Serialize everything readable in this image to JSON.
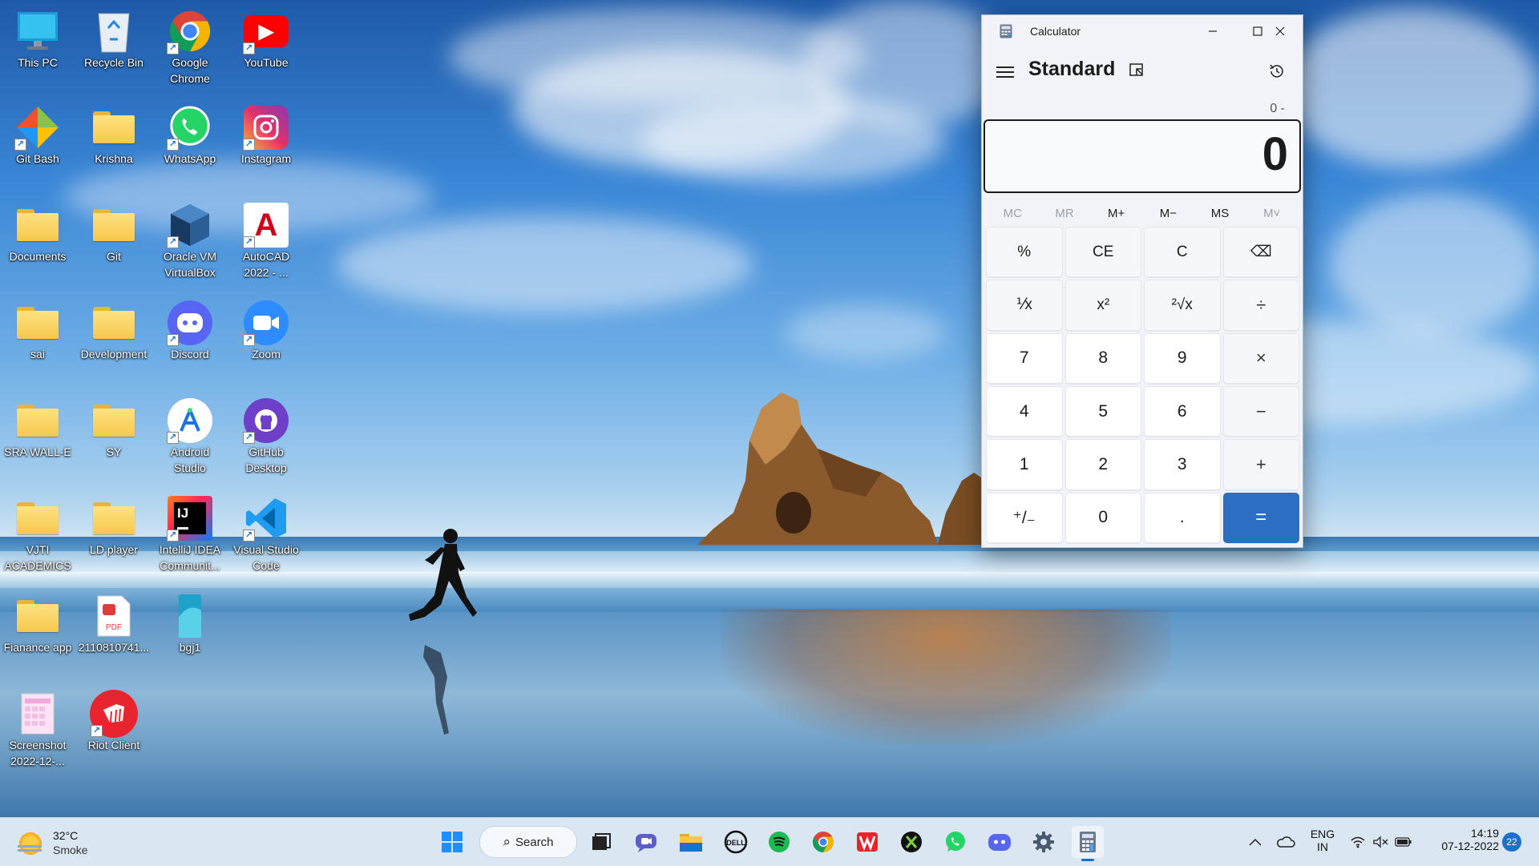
{
  "desktop": {
    "icons": [
      {
        "label_lines": [
          "This PC"
        ],
        "icon": "this-pc-icon"
      },
      {
        "label_lines": [
          "Recycle Bin"
        ],
        "icon": "recycle-bin-icon"
      },
      {
        "label_lines": [
          "Google",
          "Chrome"
        ],
        "icon": "chrome-icon"
      },
      {
        "label_lines": [
          "YouTube"
        ],
        "icon": "youtube-icon"
      },
      {
        "label_lines": [
          "Git Bash"
        ],
        "icon": "git-bash-icon"
      },
      {
        "label_lines": [
          "Krishna"
        ],
        "icon": "folder-icon"
      },
      {
        "label_lines": [
          "WhatsApp"
        ],
        "icon": "whatsapp-icon"
      },
      {
        "label_lines": [
          "Instagram"
        ],
        "icon": "instagram-icon"
      },
      {
        "label_lines": [
          "Documents"
        ],
        "icon": "folder-icon"
      },
      {
        "label_lines": [
          "Git"
        ],
        "icon": "folder-icon"
      },
      {
        "label_lines": [
          "Oracle VM",
          "VirtualBox"
        ],
        "icon": "virtualbox-icon"
      },
      {
        "label_lines": [
          "AutoCAD",
          "2022 - ..."
        ],
        "icon": "autocad-icon"
      },
      {
        "label_lines": [
          "sai"
        ],
        "icon": "folder-icon"
      },
      {
        "label_lines": [
          "Development"
        ],
        "icon": "folder-icon"
      },
      {
        "label_lines": [
          "Discord"
        ],
        "icon": "discord-icon"
      },
      {
        "label_lines": [
          "Zoom"
        ],
        "icon": "zoom-icon"
      },
      {
        "label_lines": [
          "SRA WALL-E"
        ],
        "icon": "folder-icon"
      },
      {
        "label_lines": [
          "SY"
        ],
        "icon": "folder-icon"
      },
      {
        "label_lines": [
          "Android",
          "Studio"
        ],
        "icon": "android-studio-icon"
      },
      {
        "label_lines": [
          "GitHub",
          "Desktop"
        ],
        "icon": "github-desktop-icon"
      },
      {
        "label_lines": [
          "VJTI",
          "ACADEMICS"
        ],
        "icon": "folder-icon"
      },
      {
        "label_lines": [
          "LD player"
        ],
        "icon": "folder-icon"
      },
      {
        "label_lines": [
          "IntelliJ IDEA",
          "Communit..."
        ],
        "icon": "intellij-icon"
      },
      {
        "label_lines": [
          "Visual Studio",
          "Code"
        ],
        "icon": "vscode-icon"
      },
      {
        "label_lines": [
          "Fianance app"
        ],
        "icon": "folder-icon"
      },
      {
        "label_lines": [
          "2110810741..."
        ],
        "icon": "pdf-file-icon"
      },
      {
        "label_lines": [
          "bgj1"
        ],
        "icon": "image-file-icon"
      },
      {
        "label_lines": [
          "Screenshot",
          "2022-12-..."
        ],
        "icon": "screenshot-file-icon"
      },
      {
        "label_lines": [
          "Riot Client"
        ],
        "icon": "riot-client-icon"
      }
    ]
  },
  "calculator": {
    "window_title": "Calculator",
    "mode_title": "Standard",
    "expression": "0 -",
    "display_value": "0",
    "memory_buttons": [
      {
        "label": "MC",
        "enabled": false
      },
      {
        "label": "MR",
        "enabled": false
      },
      {
        "label": "M+",
        "enabled": true
      },
      {
        "label": "M−",
        "enabled": true
      },
      {
        "label": "MS",
        "enabled": true
      },
      {
        "label": "M˅",
        "enabled": false
      }
    ],
    "keys": [
      {
        "label": "%",
        "kind": "fn",
        "name": "percent-key"
      },
      {
        "label": "CE",
        "kind": "fn",
        "name": "clear-entry-key"
      },
      {
        "label": "C",
        "kind": "fn",
        "name": "clear-key"
      },
      {
        "label": "⌫",
        "kind": "fn",
        "name": "backspace-key"
      },
      {
        "label": "⅟x",
        "kind": "fn",
        "name": "reciprocal-key"
      },
      {
        "label": "x²",
        "kind": "fn",
        "name": "square-key"
      },
      {
        "label": "²√x",
        "kind": "fn",
        "name": "square-root-key"
      },
      {
        "label": "÷",
        "kind": "op",
        "name": "divide-key"
      },
      {
        "label": "7",
        "kind": "num",
        "name": "digit-7-key"
      },
      {
        "label": "8",
        "kind": "num",
        "name": "digit-8-key"
      },
      {
        "label": "9",
        "kind": "num",
        "name": "digit-9-key"
      },
      {
        "label": "×",
        "kind": "op",
        "name": "multiply-key"
      },
      {
        "label": "4",
        "kind": "num",
        "name": "digit-4-key"
      },
      {
        "label": "5",
        "kind": "num",
        "name": "digit-5-key"
      },
      {
        "label": "6",
        "kind": "num",
        "name": "digit-6-key"
      },
      {
        "label": "−",
        "kind": "op",
        "name": "subtract-key"
      },
      {
        "label": "1",
        "kind": "num",
        "name": "digit-1-key"
      },
      {
        "label": "2",
        "kind": "num",
        "name": "digit-2-key"
      },
      {
        "label": "3",
        "kind": "num",
        "name": "digit-3-key"
      },
      {
        "label": "+",
        "kind": "op",
        "name": "add-key"
      },
      {
        "label": "⁺/₋",
        "kind": "num",
        "name": "negate-key"
      },
      {
        "label": "0",
        "kind": "num",
        "name": "digit-0-key"
      },
      {
        "label": ".",
        "kind": "num",
        "name": "decimal-key"
      },
      {
        "label": "=",
        "kind": "eq",
        "name": "equals-key"
      }
    ],
    "colors": {
      "accent": "#2a6fc1"
    }
  },
  "taskbar": {
    "weather": {
      "temp": "32°C",
      "condition": "Smoke"
    },
    "search_label": "Search",
    "pinned_apps": [
      {
        "name": "start-button",
        "icon": "windows-start-icon"
      },
      {
        "name": "task-view-button",
        "icon": "task-view-icon"
      },
      {
        "name": "teams-chat-button",
        "icon": "chat-icon"
      },
      {
        "name": "file-explorer-button",
        "icon": "folder-icon"
      },
      {
        "name": "dell-button",
        "icon": "dell-icon"
      },
      {
        "name": "spotify-button",
        "icon": "spotify-icon"
      },
      {
        "name": "chrome-button",
        "icon": "chrome-icon"
      },
      {
        "name": "wps-office-button",
        "icon": "wps-icon"
      },
      {
        "name": "xbox-button",
        "icon": "xbox-icon"
      },
      {
        "name": "whatsapp-button",
        "icon": "whatsapp-icon"
      },
      {
        "name": "discord-button",
        "icon": "discord-icon"
      },
      {
        "name": "settings-button",
        "icon": "gear-icon"
      },
      {
        "name": "calculator-button",
        "icon": "calculator-icon"
      }
    ],
    "tray": {
      "language_line1": "ENG",
      "language_line2": "IN",
      "time": "14:19",
      "date": "07-12-2022",
      "notification_count": "22"
    }
  }
}
